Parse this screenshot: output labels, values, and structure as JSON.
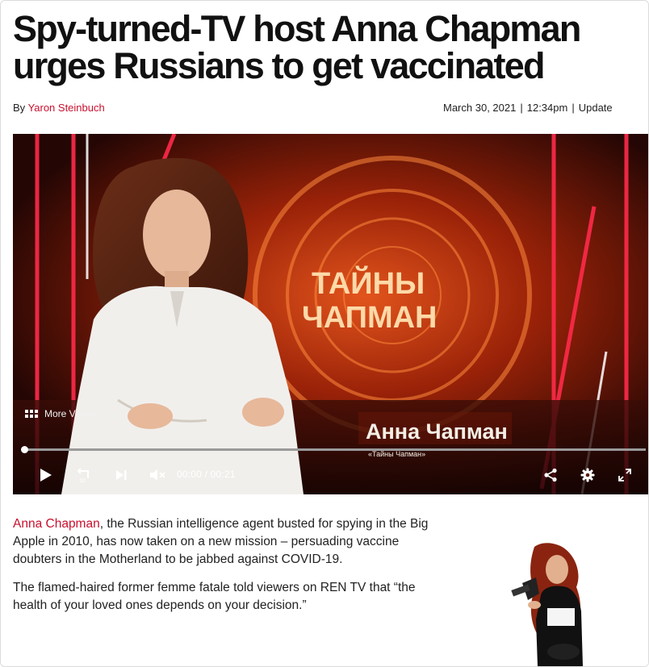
{
  "article": {
    "headline": "Spy-turned-TV host Anna Chapman urges Russians to get vaccinated",
    "byline_prefix": "By ",
    "author": "Yaron Steinbuch",
    "date": "March 30, 2021",
    "time": "12:34pm",
    "updated_label": "Update",
    "separator": "|"
  },
  "video": {
    "overlay_title_line1": "ТАЙНЫ",
    "overlay_title_line2": "ЧАПМАН",
    "lower_third_name": "Анна Чапман",
    "lower_third_show": "«Тайны Чапман»",
    "more_videos_label": "More Videos",
    "current_time": "00:00",
    "duration": "00:21",
    "time_separator": " / ",
    "progress": 0,
    "rewind_seconds": "10",
    "icons": {
      "play": "play-icon",
      "rewind": "rewind-10-icon",
      "next": "skip-next-icon",
      "mute": "volume-muted-icon",
      "share": "share-icon",
      "settings": "gear-icon",
      "fullscreen": "fullscreen-icon",
      "more": "grid-icon"
    }
  },
  "body": {
    "p1_link": "Anna Chapman",
    "p1_rest": ", the Russian intelligence agent busted for spying in the Big Apple in 2010, has now taken on a new mission – persuading vaccine doubters in the Motherland to be jabbed against COVID-19.",
    "p2": "The flamed-haired former femme fatale told viewers on REN TV that “the health of your loved ones depends on your decision.”"
  },
  "colors": {
    "accent_red": "#c8102e",
    "headline": "#111111",
    "video_bg": "#2a0a06"
  }
}
